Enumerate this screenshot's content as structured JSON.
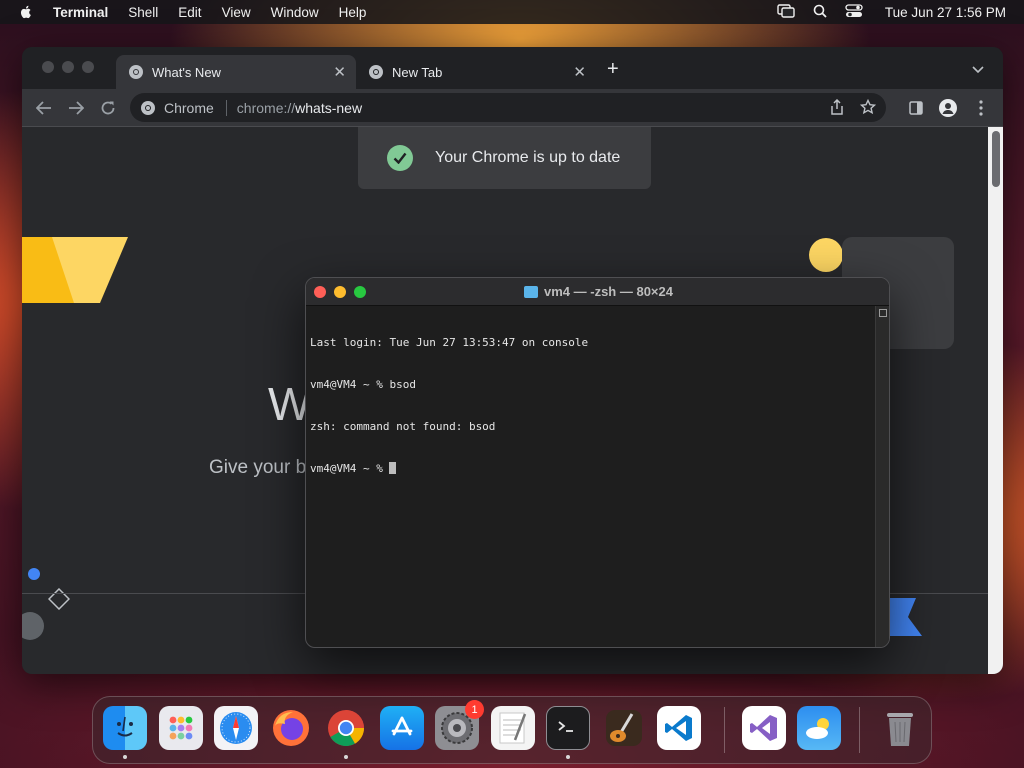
{
  "menubar": {
    "app_name": "Terminal",
    "items": [
      "Shell",
      "Edit",
      "View",
      "Window",
      "Help"
    ],
    "datetime": "Tue Jun 27  1:56 PM"
  },
  "chrome": {
    "tabs": [
      {
        "label": "What's New",
        "active": true
      },
      {
        "label": "New Tab",
        "active": false
      }
    ],
    "omnibox": {
      "site_label": "Chrome",
      "url_scheme": "chrome://",
      "url_path": "whats-new"
    },
    "toast": "Your Chrome is up to date",
    "hero_title": "W",
    "hero_subtitle": "Give your b",
    "accent_colors": {
      "yellow": "#fdd663",
      "green": "#81c995",
      "blue": "#4285f4"
    }
  },
  "terminal": {
    "title": "vm4 — -zsh — 80×24",
    "lines": [
      "Last login: Tue Jun 27 13:53:47 on console",
      "vm4@VM4 ~ % bsod",
      "zsh: command not found: bsod",
      "vm4@VM4 ~ % "
    ]
  },
  "dock": {
    "items": [
      {
        "name": "Finder",
        "icon": "finder-icon",
        "running": true
      },
      {
        "name": "Launchpad",
        "icon": "launchpad-icon",
        "running": false
      },
      {
        "name": "Safari",
        "icon": "safari-icon",
        "running": false
      },
      {
        "name": "Firefox",
        "icon": "firefox-icon",
        "running": false
      },
      {
        "name": "Google Chrome",
        "icon": "chrome-icon",
        "running": true
      },
      {
        "name": "App Store",
        "icon": "app-store-icon",
        "running": false
      },
      {
        "name": "System Settings",
        "icon": "system-settings-icon",
        "running": false,
        "badge": "1"
      },
      {
        "name": "TextEdit",
        "icon": "textedit-icon",
        "running": false
      },
      {
        "name": "Terminal",
        "icon": "terminal-icon",
        "running": true
      },
      {
        "name": "GarageBand",
        "icon": "garageband-icon",
        "running": false
      },
      {
        "name": "Visual Studio Code",
        "icon": "vscode-icon",
        "running": false
      },
      {
        "name": "Visual Studio",
        "icon": "visual-studio-icon",
        "running": false
      },
      {
        "name": "Weather",
        "icon": "weather-icon",
        "running": false
      },
      {
        "name": "Trash",
        "icon": "trash-icon",
        "running": false
      }
    ]
  }
}
